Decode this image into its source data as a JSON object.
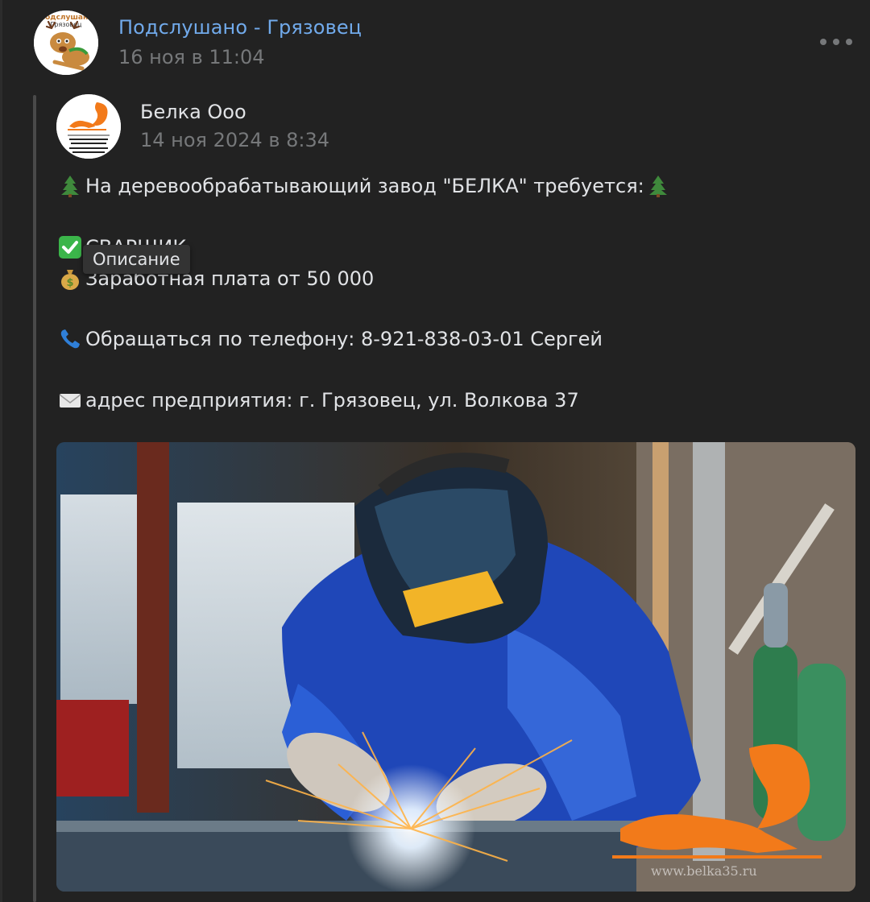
{
  "post": {
    "group_name": "Подслушано - Грязовец",
    "date": "16 ноя в 11:04",
    "group_avatar_text": [
      "Подслушано",
      "Грязовец"
    ],
    "repost": {
      "author_name": "Белка Ооо",
      "date": "14 ноя 2024 в 8:34",
      "lines": [
        {
          "icon": "tree-icon",
          "text": "На деревообрабатывающий завод \"БЕЛКА\" требуется:",
          "trailing_icon": "tree-icon"
        },
        {
          "icon": "check-mark-icon",
          "text": "СВАРЩИК"
        },
        {
          "icon": "money-bag-icon",
          "text": "Заработная плата от 50 000"
        },
        {
          "icon": "phone-icon",
          "text": "Обращаться по телефону: 8-921-838-03-01 Сергей"
        },
        {
          "icon": "envelope-icon",
          "text": "адрес предприятия: г. Грязовец, ул. Волкова 37"
        }
      ],
      "photo": {
        "watermark": "www.belka35.ru"
      }
    }
  },
  "tooltip": {
    "text": "Описание"
  },
  "colors": {
    "background": "#222222",
    "link": "#71aaeb",
    "text": "#e1e3e6",
    "muted": "#76787a",
    "brand_orange": "#f27a1a"
  }
}
